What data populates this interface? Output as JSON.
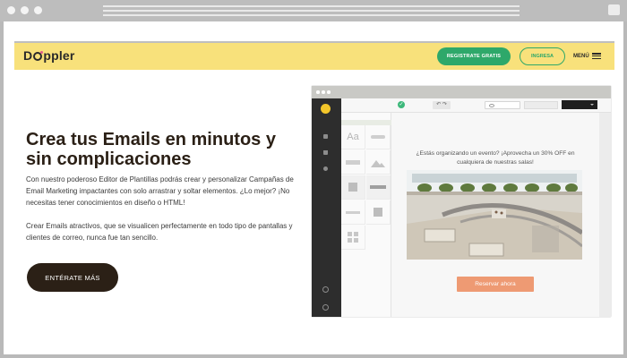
{
  "header": {
    "logo_text": "Doppler",
    "registrate_label": "REGISTRATE GRATIS",
    "ingresa_label": "INGRESA",
    "menu_label": "MENÚ"
  },
  "hero": {
    "headline_line1": "Crea tus Emails en minutos y",
    "headline_line2": "sin complicaciones",
    "paragraph1": "Con nuestro poderoso Editor de Plantillas podrás crear y personalizar Campañas de Email Marketing impactantes con solo arrastrar y soltar elementos. ¿Lo mejor? ¡No necesitas tener conocimientos en diseño o HTML!",
    "paragraph2": "Crear Emails atractivos, que se visualicen perfectamente en todo tipo de pantallas y clientes de correo, nunca fue tan sencillo.",
    "cta_label": "ENTÉRATE MÁS"
  },
  "editor": {
    "text_block_glyph": "Aa",
    "email_line1": "¿Estás organizando un evento? ¡Aprovecha un 30% OFF en",
    "email_line2": "cualquiera de nuestras salas!",
    "reservar_label": "Reservar ahora"
  },
  "colors": {
    "header_bg": "#f8e17b",
    "brand_green": "#2ea86a",
    "dark_brown": "#2b2016",
    "cta_orange": "#ee9a73"
  }
}
